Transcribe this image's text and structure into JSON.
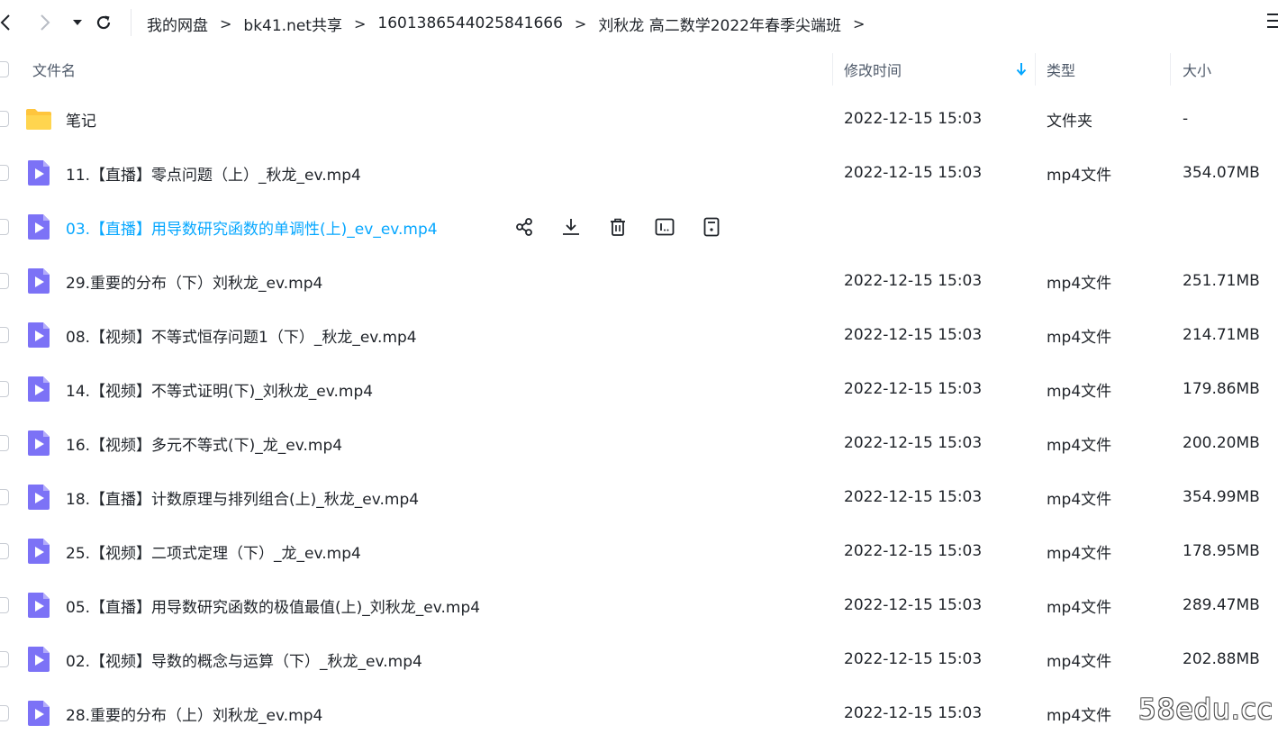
{
  "toolbar": {
    "breadcrumb": [
      "我的网盘",
      "bk41.net共享",
      "1601386544025841666",
      "刘秋龙 高二数学2022年春季尖端班"
    ],
    "separator": ">"
  },
  "columns": {
    "name": "文件名",
    "modified": "修改时间",
    "type": "类型",
    "size": "大小"
  },
  "sort": {
    "column": "modified",
    "direction": "desc"
  },
  "files": [
    {
      "name": "笔记",
      "date": "2022-12-15 15:03",
      "type": "文件夹",
      "size": "-",
      "icon": "folder-icon"
    },
    {
      "name": "11.【直播】零点问题（上）_秋龙_ev.mp4",
      "date": "2022-12-15 15:03",
      "type": "mp4文件",
      "size": "354.07MB",
      "icon": "video-file-icon"
    },
    {
      "name": "03.【直播】用导数研究函数的单调性(上)_ev_ev.mp4",
      "date": "",
      "type": "",
      "size": "",
      "icon": "video-file-icon",
      "hovered": true
    },
    {
      "name": "29.重要的分布（下）刘秋龙_ev.mp4",
      "date": "2022-12-15 15:03",
      "type": "mp4文件",
      "size": "251.71MB",
      "icon": "video-file-icon"
    },
    {
      "name": "08.【视频】不等式恒存问题1（下）_秋龙_ev.mp4",
      "date": "2022-12-15 15:03",
      "type": "mp4文件",
      "size": "214.71MB",
      "icon": "video-file-icon"
    },
    {
      "name": "14.【视频】不等式证明(下)_刘秋龙_ev.mp4",
      "date": "2022-12-15 15:03",
      "type": "mp4文件",
      "size": "179.86MB",
      "icon": "video-file-icon"
    },
    {
      "name": "16.【视频】多元不等式(下)_龙_ev.mp4",
      "date": "2022-12-15 15:03",
      "type": "mp4文件",
      "size": "200.20MB",
      "icon": "video-file-icon"
    },
    {
      "name": "18.【直播】计数原理与排列组合(上)_秋龙_ev.mp4",
      "date": "2022-12-15 15:03",
      "type": "mp4文件",
      "size": "354.99MB",
      "icon": "video-file-icon"
    },
    {
      "name": "25.【视频】二项式定理（下）_龙_ev.mp4",
      "date": "2022-12-15 15:03",
      "type": "mp4文件",
      "size": "178.95MB",
      "icon": "video-file-icon"
    },
    {
      "name": "05.【直播】用导数研究函数的极值最值(上)_刘秋龙_ev.mp4",
      "date": "2022-12-15 15:03",
      "type": "mp4文件",
      "size": "289.47MB",
      "icon": "video-file-icon"
    },
    {
      "name": "02.【视频】导数的概念与运算（下）_秋龙_ev.mp4",
      "date": "2022-12-15 15:03",
      "type": "mp4文件",
      "size": "202.88MB",
      "icon": "video-file-icon"
    },
    {
      "name": "28.重要的分布（上）刘秋龙_ev.mp4",
      "date": "2022-12-15 15:03",
      "type": "mp4文件",
      "size": "",
      "icon": "video-file-icon"
    }
  ],
  "hover_actions": [
    "share-icon",
    "download-icon",
    "delete-icon",
    "rename-icon",
    "more-info-icon"
  ],
  "watermark": "58edu.cc",
  "colors": {
    "accent": "#06a7ff",
    "folder": "#ffc53d",
    "video": "#7c72f6",
    "text": "#1f2329",
    "muted": "#4e5969"
  }
}
